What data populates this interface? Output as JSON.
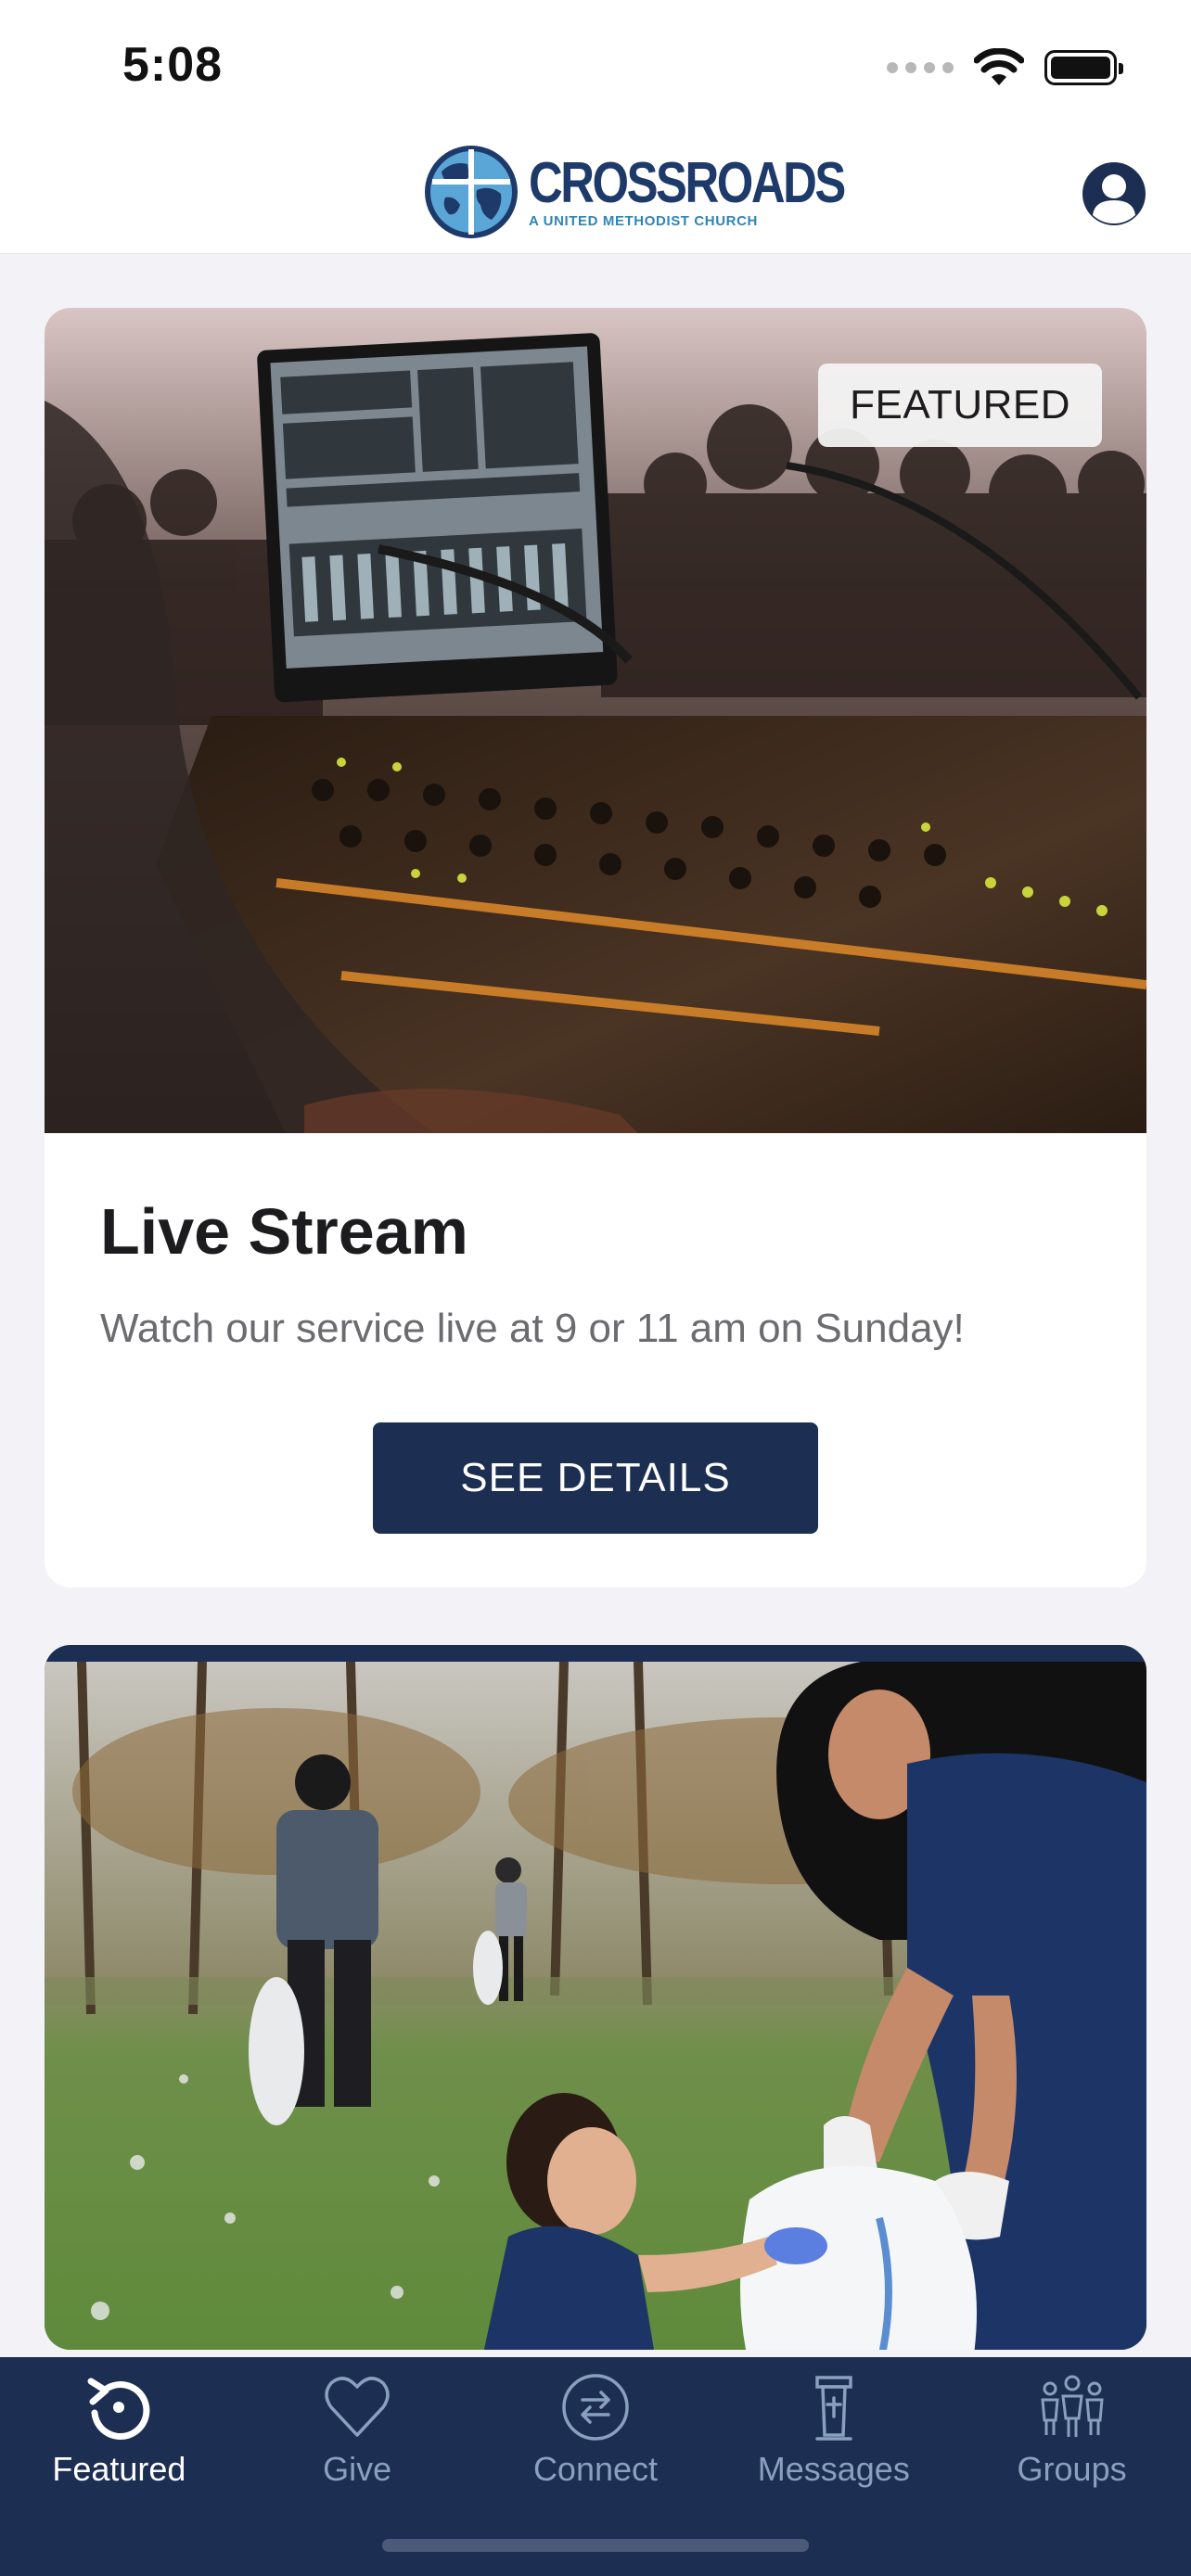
{
  "status_bar": {
    "time": "5:08"
  },
  "header": {
    "logo_name": "CROSSROADS",
    "logo_tagline": "A UNITED METHODIST CHURCH"
  },
  "cards": [
    {
      "badge": "FEATURED",
      "title": "Live Stream",
      "description": "Watch our service live at 9 or 11 am on Sunday!",
      "button_label": "SEE DETAILS"
    }
  ],
  "tabs": [
    {
      "label": "Featured",
      "icon": "featured-icon",
      "active": true
    },
    {
      "label": "Give",
      "icon": "heart-icon",
      "active": false
    },
    {
      "label": "Connect",
      "icon": "connect-icon",
      "active": false
    },
    {
      "label": "Messages",
      "icon": "pulpit-icon",
      "active": false
    },
    {
      "label": "Groups",
      "icon": "groups-icon",
      "active": false
    }
  ],
  "colors": {
    "brand_navy": "#1c2e52",
    "logo_blue": "#1d3a6b",
    "tab_inactive": "#8aa0bf"
  }
}
